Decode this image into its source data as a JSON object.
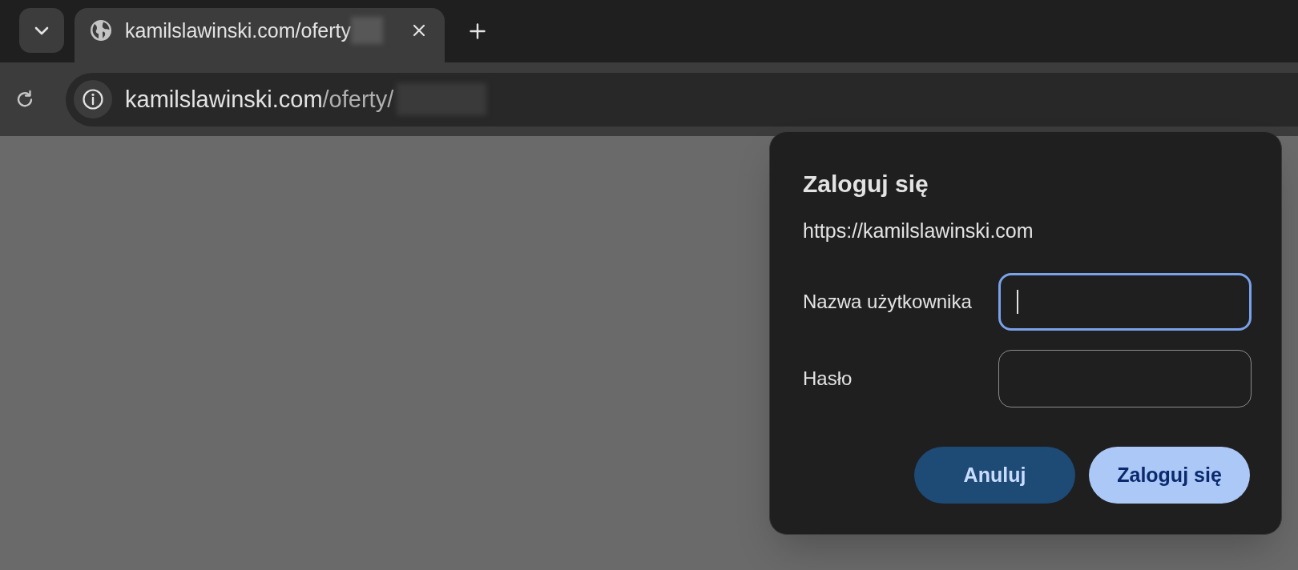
{
  "tab_strip": {
    "tabs": [
      {
        "title": "kamilslawinski.com/oferty",
        "selected": true
      }
    ]
  },
  "toolbar": {
    "address": {
      "host": "kamilslawinski.com",
      "path": "/oferty/"
    }
  },
  "dialog": {
    "title": "Zaloguj się",
    "origin": "https://kamilslawinski.com",
    "fields": [
      {
        "label": "Nazwa użytkownika",
        "focused": true
      },
      {
        "label": "Hasło",
        "focused": false
      }
    ],
    "buttons": [
      {
        "label": "Anuluj",
        "kind": "secondary"
      },
      {
        "label": "Zaloguj się",
        "kind": "primary"
      }
    ]
  }
}
